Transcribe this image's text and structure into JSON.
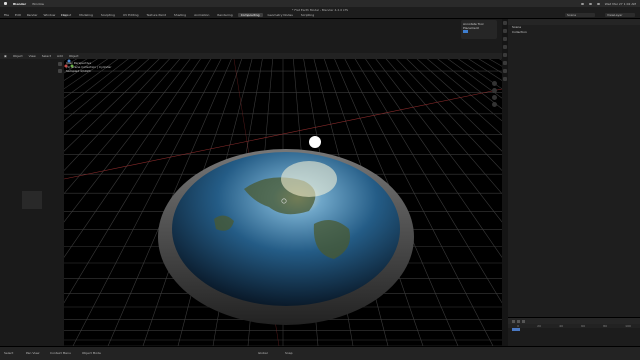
{
  "macbar": {
    "app": "Blender",
    "menu": [
      "Window"
    ],
    "clock": "Wed Mar 27 1:02 AM"
  },
  "window": {
    "title": "* Flat Earth Model - Blender 4.2.0 LTS"
  },
  "topbar": {
    "menus": [
      "File",
      "Edit",
      "Render",
      "Window",
      "Help"
    ],
    "workspaces": [
      "Layout",
      "Modeling",
      "Sculpting",
      "UV Editing",
      "Texture Paint",
      "Shading",
      "Animation",
      "Rendering",
      "Compositing",
      "Geometry Nodes",
      "Scripting"
    ],
    "active_workspace": "Compositing",
    "scene": "Scene",
    "view_layer": "ViewLayer"
  },
  "viewport": {
    "header": [
      "Object",
      "View",
      "Select",
      "Add",
      "Object"
    ],
    "overlay_lines": [
      "User Perspective",
      "(1) Scene Collection | Cylinder",
      "Sampled 1/1024"
    ],
    "annotate": {
      "label": "Annotate Tool",
      "sub": "Placement"
    }
  },
  "outliner": {
    "rows": [
      "Scene",
      "Collection"
    ]
  },
  "timeline": {
    "ticks": [
      "0",
      "20",
      "40",
      "60",
      "80",
      "100"
    ]
  },
  "status": {
    "left": [
      "Select",
      "Pan View",
      "Context Menu"
    ],
    "mode": "Object Mode",
    "center": [
      "Global",
      "Snap"
    ]
  },
  "colors": {
    "accent": "#3f7fd1",
    "grid": "#3a3a3a"
  }
}
